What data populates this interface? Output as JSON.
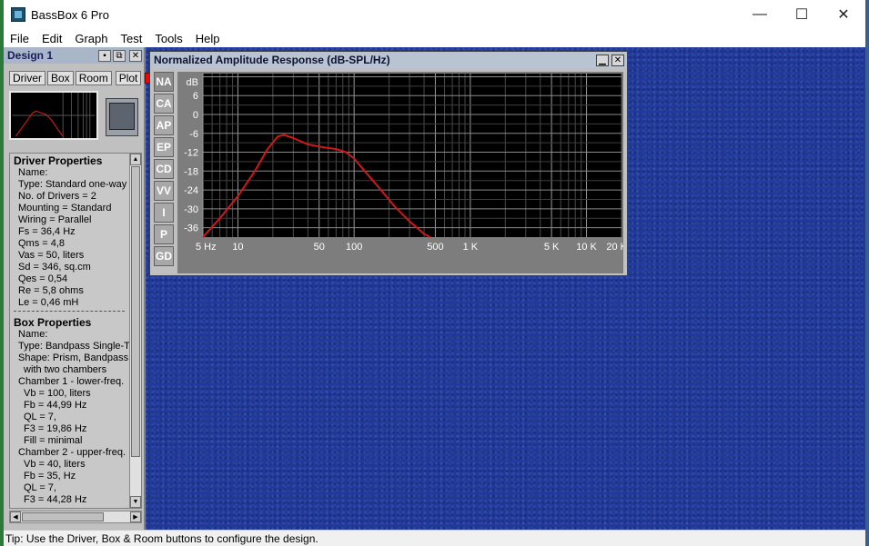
{
  "window": {
    "title": "BassBox 6 Pro",
    "minimize": "—",
    "maximize": "☐",
    "close": "✕"
  },
  "menu": [
    "File",
    "Edit",
    "Graph",
    "Test",
    "Tools",
    "Help"
  ],
  "design": {
    "title": "Design 1",
    "tabs": [
      "Driver",
      "Box",
      "Room",
      "Plot"
    ],
    "driver_heading": "Driver Properties",
    "driver_lines": [
      "Name:",
      "Type: Standard one-way",
      "No. of Drivers = 2",
      "Mounting = Standard",
      "Wiring = Parallel",
      "Fs = 36,4 Hz",
      "Qms = 4,8",
      "Vas = 50, liters",
      "Sd = 346, sq.cm",
      "Qes = 0,54",
      "Re = 5,8 ohms",
      "Le = 0,46 mH"
    ],
    "box_heading": "Box Properties",
    "box_lines": [
      {
        "t": "Name:",
        "ind": false
      },
      {
        "t": "Type: Bandpass Single-Tu",
        "ind": false
      },
      {
        "t": "Shape: Prism, Bandpass",
        "ind": false
      },
      {
        "t": "with two chambers",
        "ind": true
      },
      {
        "t": "Chamber 1 - lower-freq.",
        "ind": false
      },
      {
        "t": "Vb = 100, liters",
        "ind": true
      },
      {
        "t": "Fb = 44,99 Hz",
        "ind": true
      },
      {
        "t": "QL = 7,",
        "ind": true
      },
      {
        "t": "F3 = 19,86 Hz",
        "ind": true
      },
      {
        "t": "Fill = minimal",
        "ind": true
      },
      {
        "t": "Chamber 2 - upper-freq.",
        "ind": false
      },
      {
        "t": "Vb = 40, liters",
        "ind": true
      },
      {
        "t": "Fb = 35, Hz",
        "ind": true
      },
      {
        "t": "QL = 7,",
        "ind": true
      },
      {
        "t": "F3 = 44,28 Hz",
        "ind": true
      }
    ]
  },
  "graph": {
    "title": "Normalized Amplitude Response (dB-SPL/Hz)",
    "side_tabs": [
      "NA",
      "CA",
      "AP",
      "EP",
      "CD",
      "VV",
      "I",
      "P",
      "GD"
    ],
    "active_tab": "NA"
  },
  "chart_data": {
    "type": "line",
    "ylabel": "dB",
    "y_ticks": [
      6,
      0,
      -6,
      -12,
      -18,
      -24,
      -30,
      -36
    ],
    "ylim": [
      -39,
      13
    ],
    "x_ticks": [
      {
        "v": 5,
        "label": "5 Hz"
      },
      {
        "v": 10,
        "label": "10"
      },
      {
        "v": 50,
        "label": "50"
      },
      {
        "v": 100,
        "label": "100"
      },
      {
        "v": 500,
        "label": "500"
      },
      {
        "v": 1000,
        "label": "1 K"
      },
      {
        "v": 5000,
        "label": "5 K"
      },
      {
        "v": 10000,
        "label": "10 K"
      },
      {
        "v": 20000,
        "label": "20 K"
      }
    ],
    "xlim": [
      5,
      20000
    ],
    "x_scale": "log",
    "grid": true,
    "line_color": "#d01818",
    "series": [
      {
        "x": [
          5,
          7,
          10,
          14,
          18,
          22,
          25,
          30,
          40,
          55,
          70,
          85,
          100,
          130,
          170,
          220,
          300,
          400,
          450
        ],
        "y": [
          -39,
          -33,
          -26,
          -18,
          -11,
          -7,
          -6.5,
          -7.5,
          -9.5,
          -10.5,
          -11,
          -12,
          -14,
          -19,
          -24,
          -29,
          -34,
          -38,
          -39.5
        ]
      }
    ]
  },
  "status": "Tip: Use the Driver, Box & Room buttons to configure the design."
}
